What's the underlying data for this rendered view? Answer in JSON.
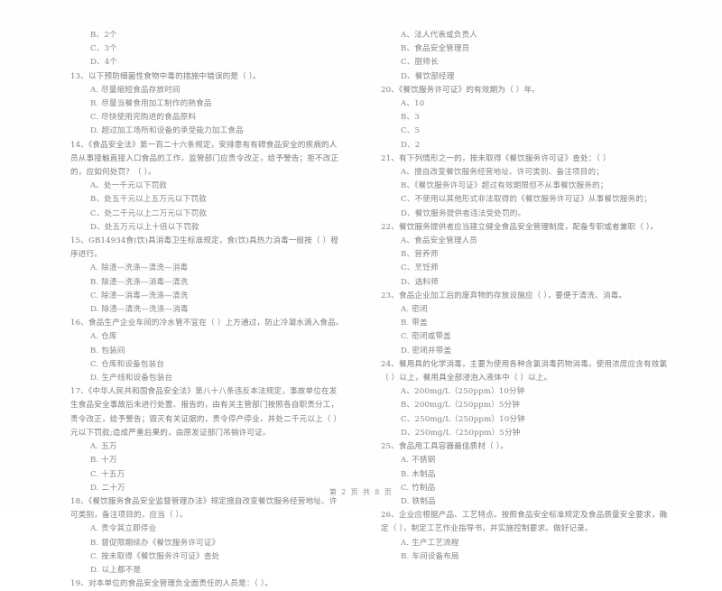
{
  "document": {
    "type": "scanned-exam-paper",
    "footer": "第 2 页 共 8 页",
    "page_number": "2",
    "total_pages": "8"
  },
  "left_column": {
    "orphan_options": [
      "B、2个",
      "C、3个",
      "D、4个"
    ],
    "questions": [
      {
        "number": "13",
        "stem": "13、以下预防细菌性食物中毒的措施中错误的是（    ）。",
        "options": [
          "A. 尽量缩短食品存放时间",
          "B. 尽量当餐食用加工制作的熟食品",
          "C. 尽快使用完购进的食品原料",
          "D. 超过加工场所和设备的承受能力加工食品"
        ]
      },
      {
        "number": "14",
        "stem": "14、《食品安全法》第一百二十六条规定，安排患有有碍食品安全的疾病的人员从事接触直接入口食品的工作，监管部门应责令改正，给予警告；拒不改正的，应如何处罚？（    ）。",
        "options": [
          "A、处一千元以下罚款",
          "B、处五千元以上五万元以下罚款",
          "C、处二千元以上二万元以下罚款",
          "D、处五万元以上十倍以下罚款"
        ]
      },
      {
        "number": "15",
        "stem": "15、GB14934食(饮)具消毒卫生标准规定，食(饮)具热力消毒一般按（    ）程序进行。",
        "options": [
          "A. 除渣—洗涤—清洗—消毒",
          "B. 除渣—洗涤—消毒—清洗",
          "C. 除渣—消毒—洗涤—清洗",
          "D. 除渣—清洗—洗涤—消毒"
        ]
      },
      {
        "number": "16",
        "stem": "16、食品生产企业车间的冷水管不宜在（    ）上方通过，防止冷凝水滴入食品。",
        "options": [
          "A. 仓库",
          "B. 包装间",
          "C. 仓库和设备包装台",
          "D. 生产线和设备包装台"
        ]
      },
      {
        "number": "17",
        "stem": "17、《中华人民共和国食品安全法》第八十八条违反本法规定，事故单位在发生食品安全事故后未进行处置、报告的，由有关主管部门按照各自职责分工，责令改正，给予警告；毁灭有关证据的，责令停产停业，并处二千元以上（        ）元以下罚款;造成严重后果的，由原发证部门吊销许可证。",
        "options": [
          "A. 五万",
          "B. 十万",
          "C. 十五万",
          "D. 二十万"
        ]
      },
      {
        "number": "18",
        "stem": "18、《餐饮服务食品安全监督管理办法》规定擅自改变餐饮服务经营地址、许可类别，备注项目的，应当（    ）。",
        "options": [
          "A. 责令其立即停业",
          "B. 督促限期续办《餐饮服务许可证》",
          "C. 按未取得《餐饮服务许可证》查处",
          "D. 以上都不是"
        ]
      },
      {
        "number": "19",
        "stem": "19、对本单位的食品安全管理负全面责任的人员是：（      ）。",
        "options": []
      }
    ]
  },
  "right_column": {
    "orphan_options": [
      "A、法人代表或负责人",
      "B、食品安全管理员",
      "C、厨师长",
      "D、餐饮部经理"
    ],
    "questions": [
      {
        "number": "20",
        "stem": "20、《餐饮服务许可证》的有效期为（    ）年。",
        "options": [
          "A、10",
          "B、3",
          "C、5",
          "D、2"
        ]
      },
      {
        "number": "21",
        "stem": "21、有下列情形之一的，按未取得《餐饮服务许可证》查处：（    ）",
        "options": [
          "A、擅自改变餐饮服务经营地址、许可类别、备注项目的；",
          "B、《餐饮服务许可证》超过有效期限但不从事餐饮服务的；",
          "C、不使用以其他形式非法取得的《餐饮服务许可证》从事餐饮服务的；",
          "D、餐饮服务提供者违法受处罚的。"
        ]
      },
      {
        "number": "22",
        "stem": "22、餐饮服务提供者应当建立健全食品安全管理制度，配备专职或者兼职（      ）。",
        "options": [
          "A、食品安全管理人员",
          "B、营养师",
          "C、烹饪师",
          "D、选料师"
        ]
      },
      {
        "number": "23",
        "stem": "23、食品企业加工后的废弃物的存放设施应（      ），要便于清洗、消毒。",
        "options": [
          "A. 密闭",
          "B. 带盖",
          "C. 密闭或带盖",
          "D. 密闭并带盖"
        ]
      },
      {
        "number": "24",
        "stem": "24、餐用具的化学消毒，主要为使用各种含氯消毒药物消毒。使用浓度应含有效氯（      ）以上，餐用具全部浸泡入液体中（      ）以上。",
        "options": [
          "A、200mg/L（250ppm）10分钟",
          "B、200mg/L（250ppm）5分钟",
          "C、250mg/L（250ppm）10分钟",
          "D、250mg/L（250ppm）5分钟"
        ]
      },
      {
        "number": "25",
        "stem": "25、食品用工具容器最佳质材（      ）。",
        "options": [
          "A. 不锈钢",
          "B. 木制品",
          "C. 竹制品",
          "D. 铁制品"
        ]
      },
      {
        "number": "26",
        "stem": "26、企业应根据产品、工艺特点。按照食品安全标准规定及食品质量安全要求，确定（      ），制定工艺作业指导书，并实施控制要求。做好记录。",
        "options": [
          "A. 生产工艺流程",
          "B. 车间设备布局"
        ]
      }
    ]
  }
}
